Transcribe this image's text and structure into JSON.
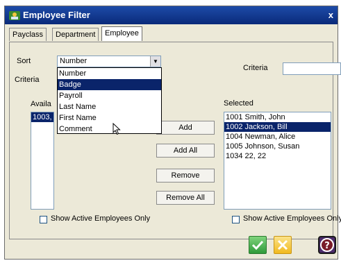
{
  "window": {
    "title": "Employee Filter",
    "close_glyph": "x"
  },
  "tabs": [
    {
      "label": "Payclass",
      "active": false
    },
    {
      "label": "Department",
      "active": false
    },
    {
      "label": "Employee",
      "active": true
    }
  ],
  "filter": {
    "sort_label": "Sort",
    "sort_value": "Number",
    "criteria_label_left": "Criteria",
    "criteria_label_right": "Criteria",
    "criteria_value": "",
    "dropdown_options": [
      "Number",
      "Badge",
      "Payroll",
      "Last Name",
      "First Name",
      "Comment"
    ],
    "dropdown_highlight_index": 1
  },
  "available": {
    "label": "Availa",
    "items": [
      "1003,"
    ]
  },
  "selected": {
    "label": "Selected",
    "items": [
      "1001 Smith, John",
      "1002 Jackson, Bill",
      "1004 Newman, Alice",
      "1005 Johnson, Susan",
      "1034 22, 22"
    ],
    "highlight_index": 1
  },
  "buttons": {
    "add": "Add",
    "add_all": "Add All",
    "remove": "Remove",
    "remove_all": "Remove All"
  },
  "checkboxes": {
    "left": "Show Active Employees Only",
    "right": "Show Active Employees Only"
  },
  "footer_icons": [
    "ok-check-icon",
    "cancel-x-icon",
    "help-question-icon"
  ],
  "colors": {
    "title_bar": "#0a2a7a",
    "selection": "#0a246a",
    "ok_green": "#3fae49",
    "cancel_yellow": "#f2c531",
    "help_purple": "#4b2a6b"
  }
}
